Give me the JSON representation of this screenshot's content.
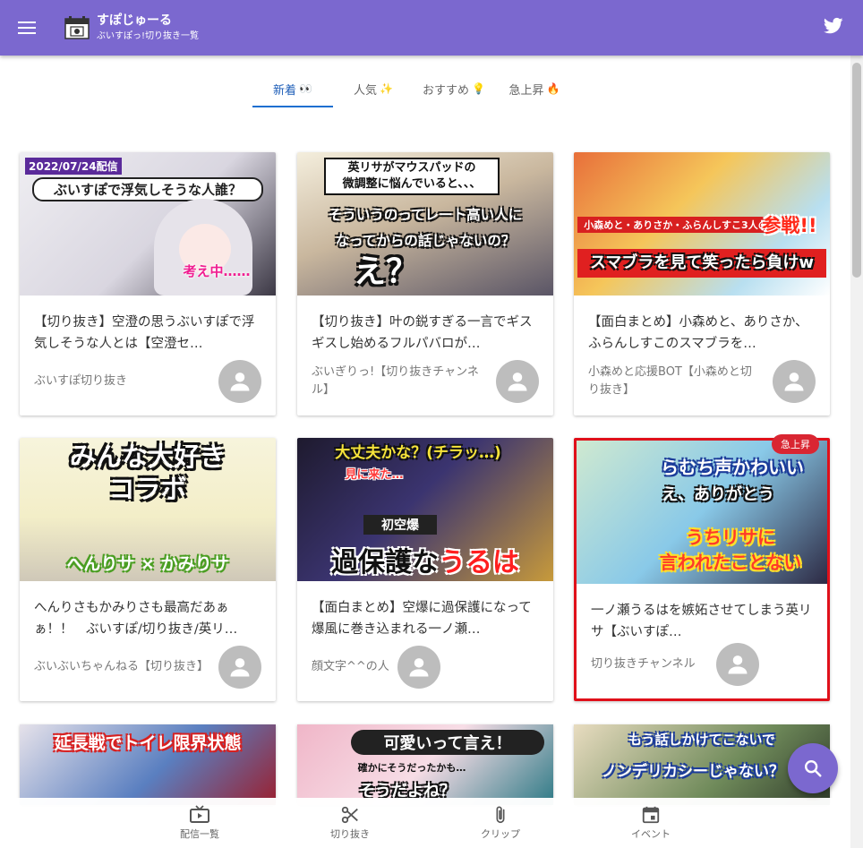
{
  "header": {
    "title": "すぽじゅーる",
    "subtitle": "ぶいすぽっ!切り抜き一覧"
  },
  "tabs": [
    {
      "label": "新着",
      "emoji": "👀"
    },
    {
      "label": "人気",
      "emoji": "✨"
    },
    {
      "label": "おすすめ",
      "emoji": "💡"
    },
    {
      "label": "急上昇",
      "emoji": "🔥"
    }
  ],
  "cards": [
    {
      "title": "【切り抜き】空澄の思うぶいすぽで浮気しそうな人とは【空澄セ…",
      "channel": "ぶいすぽ切り抜き",
      "thumb_text": [
        "2022/07/24配信",
        "ぶいすぽで浮気しそうな人誰？",
        "考え中……"
      ]
    },
    {
      "title": "【切り抜き】叶の鋭すぎる一言でギスギスし始めるフルパバロが…",
      "channel": "ぶいぎりっ!【切り抜きチャンネル】",
      "thumb_text": [
        "英リサがマウスパッドの",
        "微調整に悩んでいると、、、",
        "そういうのってレート高い人に",
        "なってからの話じゃないの？",
        "え？"
      ]
    },
    {
      "title": "【面白まとめ】小森めと、ありさか、ふらんしすこのスマブラを…",
      "channel": "小森めと応援BOT【小森めと切り抜き】",
      "thumb_text": [
        "小森めと・ありさか・ふらんしすこ3人の",
        "参戦!!",
        "スマブラを見て笑ったら負けw"
      ]
    },
    {
      "title": "へんりさもかみりさも最高だあぁぁ！！　ぶいすぽ/切り抜き/英リ…",
      "channel": "ぶいぶいちゃんねる【切り抜き】",
      "thumb_text": [
        "みんな大好き",
        "コラボ",
        "へんりサ × かみりサ"
      ]
    },
    {
      "title": "【面白まとめ】空爆に過保護になって爆風に巻き込まれる一ノ瀬…",
      "channel": "顔文字^^の人",
      "thumb_text": [
        "大丈夫かな？(チラッ…)",
        "見に来た…",
        "初空爆",
        "過保護な",
        "うるは"
      ]
    },
    {
      "title": "一ノ瀬うるはを嫉妬させてしまう英リサ【ぶいすぽ…",
      "channel": "切り抜きチャンネル",
      "badge": "急上昇",
      "thumb_text": [
        "らむち声かわいい",
        "え、ありがとう",
        "うちリサに",
        "言われたことない"
      ]
    }
  ],
  "partial_thumbs": [
    {
      "thumb_text": [
        "延長戦でトイレ限界状態"
      ]
    },
    {
      "thumb_text": [
        "可愛いって言え！",
        "確かにそうだったかも…",
        "そうだよね？"
      ]
    },
    {
      "thumb_text": [
        "もう話しかけてこないで",
        "ノンデリカシーじゃない？"
      ]
    }
  ],
  "bottom_nav": [
    {
      "label": "配信一覧",
      "icon": "tv-icon"
    },
    {
      "label": "切り抜き",
      "icon": "scissors-icon"
    },
    {
      "label": "クリップ",
      "icon": "paperclip-icon"
    },
    {
      "label": "イベント",
      "icon": "calendar-icon"
    }
  ],
  "colors": {
    "primary": "#7b68cf",
    "active_tab": "#1e6fd0",
    "badge": "#d92632",
    "highlight_border": "#e0101a"
  }
}
